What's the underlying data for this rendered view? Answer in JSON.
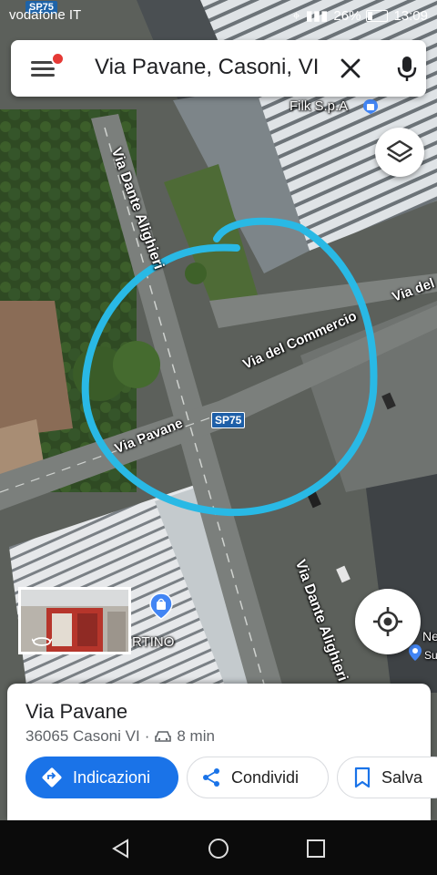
{
  "status_bar": {
    "carrier": "vodafone IT",
    "carrier_badge": "SP75",
    "battery": "26%",
    "time": "13:09"
  },
  "search": {
    "query": "Via Pavane, Casoni, VI"
  },
  "map": {
    "labels": {
      "road_dante_north": "Via Dante Alighieri",
      "road_dante_south": "Via Dante Alighieri",
      "road_commercio": "Via del Commercio",
      "road_commercio_east": "Via del",
      "road_pavane": "Via Pavane",
      "poi_filk": "Filk S.p.A",
      "poi_tino": "RTINO",
      "edge_ne": "Ne",
      "edge_su": "Su"
    },
    "route_badge": "SP75",
    "highlight_color": "#29b9e5"
  },
  "place_card": {
    "title": "Via Pavane",
    "address": "36065 Casoni VI",
    "separator": "·",
    "drive_time": "8 min",
    "buttons": {
      "directions": "Indicazioni",
      "share": "Condividi",
      "save": "Salva"
    },
    "accent_color": "#1a73e8"
  },
  "icons": [
    "menu-icon",
    "close-icon",
    "mic-icon",
    "layers-icon",
    "my-location-icon",
    "directions-icon",
    "share-icon",
    "bookmark-icon",
    "car-icon",
    "back-icon",
    "home-icon",
    "recents-icon",
    "pin-icon",
    "shopping-bag-icon",
    "street-view-icon"
  ]
}
